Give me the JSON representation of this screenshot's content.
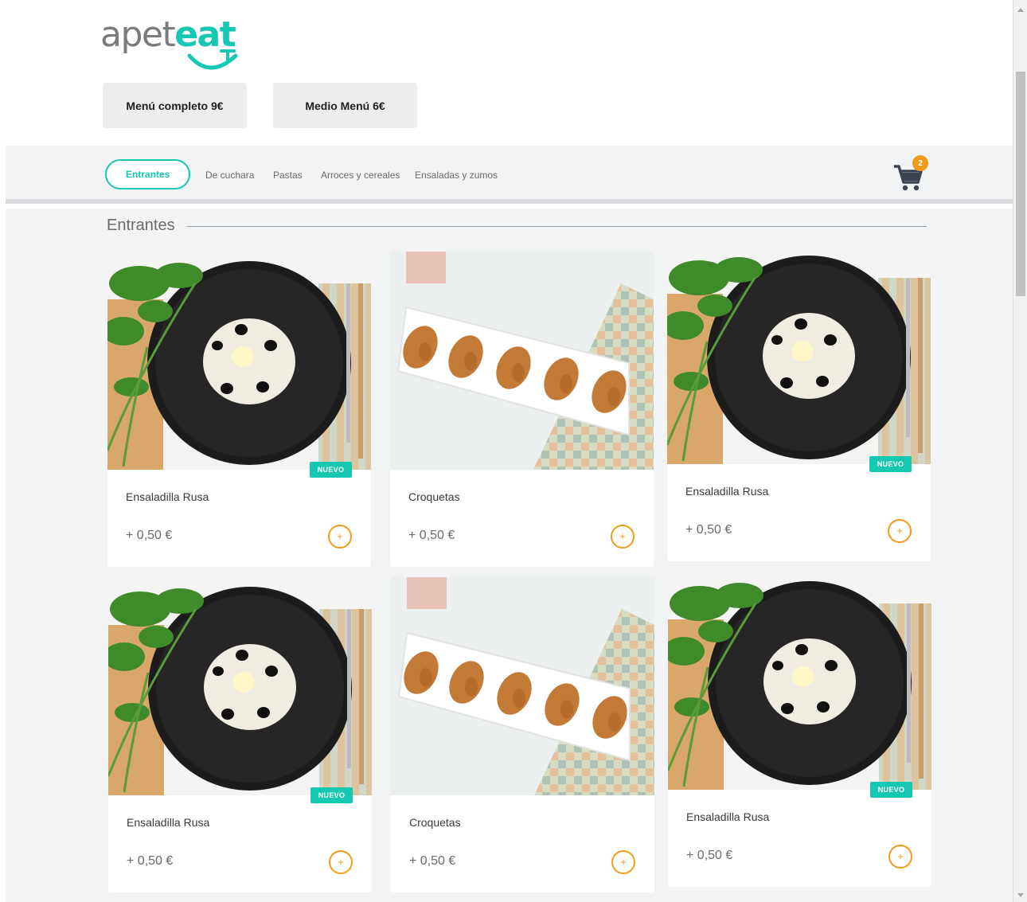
{
  "brand": {
    "logo_part1": "apet",
    "logo_part2": "eat"
  },
  "menu_buttons": [
    {
      "label": "Menú completo 9€"
    },
    {
      "label": "Medio Menú 6€"
    }
  ],
  "categories": [
    {
      "label": "Entrantes",
      "active": true
    },
    {
      "label": "De cuchara"
    },
    {
      "label": "Pastas"
    },
    {
      "label": "Arroces y cereales"
    },
    {
      "label": "Ensaladas y zumos"
    }
  ],
  "cart": {
    "count": "2",
    "icon": "cart-icon"
  },
  "section": {
    "title": "Entrantes"
  },
  "add_symbol": "+",
  "products": [
    {
      "name": "Ensaladilla Rusa",
      "price": "+ 0,50 €",
      "badge": "NUEVO",
      "image": "salad"
    },
    {
      "name": "Croquetas",
      "price": "+ 0,50 €",
      "badge": "",
      "image": "croquetas"
    },
    {
      "name": "Ensaladilla Rusa",
      "price": "+ 0,50 €",
      "badge": "NUEVO",
      "image": "salad"
    },
    {
      "name": "Ensaladilla Rusa",
      "price": "+ 0,50 €",
      "badge": "NUEVO",
      "image": "salad"
    },
    {
      "name": "Croquetas",
      "price": "+ 0,50 €",
      "badge": "",
      "image": "croquetas"
    },
    {
      "name": "Ensaladilla Rusa",
      "price": "+ 0,50 €",
      "badge": "NUEVO",
      "image": "salad"
    }
  ],
  "colors": {
    "accent": "#16c7b1",
    "orange": "#f39a1a",
    "background": "#f2f3f5"
  }
}
